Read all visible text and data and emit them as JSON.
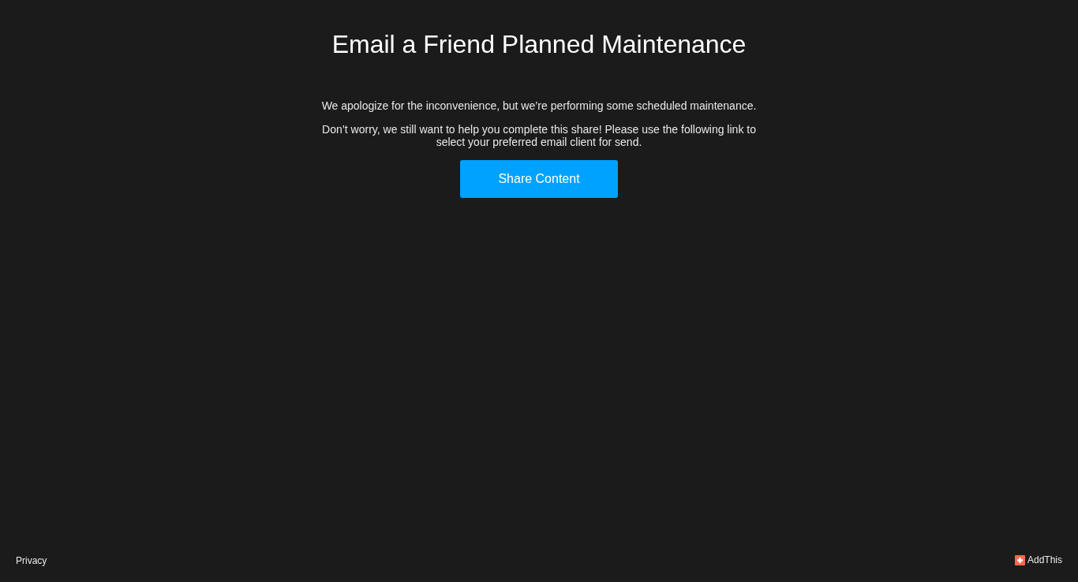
{
  "title": "Email a Friend Planned Maintenance",
  "paragraphs": [
    "We apologize for the inconvenience, but we’re performing some scheduled maintenance.",
    "Don’t worry, we still want to help you complete this share! Please use the following link to select your preferred email client for send."
  ],
  "button": "Share Content",
  "footer": {
    "privacy": "Privacy",
    "brand": "AddThis"
  }
}
